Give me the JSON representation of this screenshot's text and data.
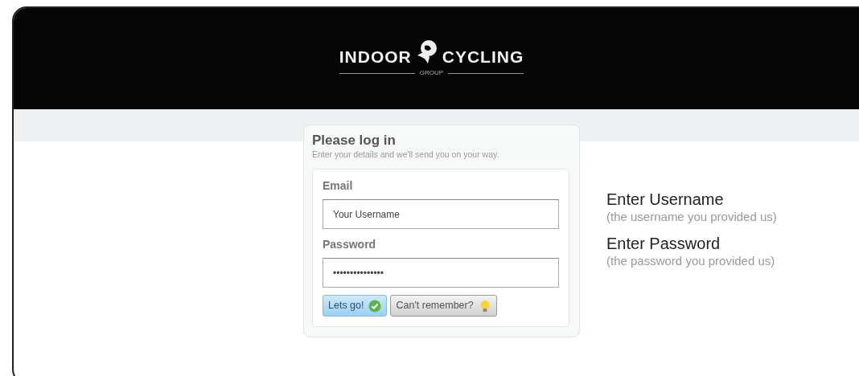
{
  "header": {
    "logo_left": "INDOOR",
    "logo_right": "CYCLING",
    "logo_sub": "GROUP"
  },
  "login": {
    "title": "Please log in",
    "subtitle": "Enter your details and we'll send you on your way.",
    "fields": [
      {
        "label": "Email",
        "value": "Your Username"
      },
      {
        "label": "Password",
        "value": "•••••••••••••••"
      }
    ],
    "buttons": [
      {
        "label": "Lets go!",
        "kind": "primary"
      },
      {
        "label": "Can't remember?",
        "kind": "secondary"
      }
    ]
  },
  "notes": [
    {
      "title": "Enter Username",
      "detail": "(the username you provided us)"
    },
    {
      "title": "Enter Password",
      "detail": "(the password you provided us)"
    }
  ]
}
